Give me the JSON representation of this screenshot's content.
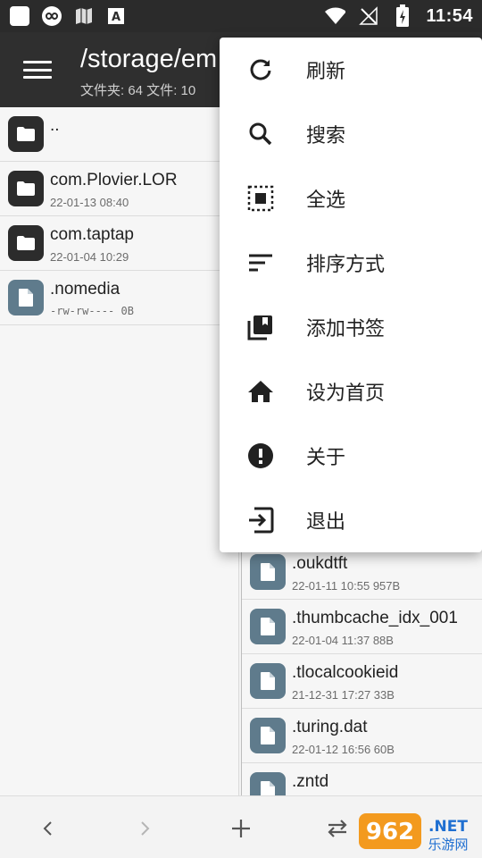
{
  "status_bar": {
    "time": "11:54",
    "left_icons": [
      "app-square-icon",
      "infinity-icon",
      "map-icon",
      "font-icon"
    ],
    "right_icons": [
      "wifi-icon",
      "no-signal-icon",
      "battery-charging-icon"
    ]
  },
  "app_bar": {
    "path": "/storage/em",
    "summary": "文件夹: 64  文件: 10"
  },
  "left_list": [
    {
      "name": "..",
      "meta": "",
      "type": "folder"
    },
    {
      "name": "com.Plovier.LOR",
      "meta": "22-01-13 08:40",
      "type": "folder"
    },
    {
      "name": "com.taptap",
      "meta": "22-01-04 10:29",
      "type": "folder"
    },
    {
      "name": ".nomedia",
      "meta": "-rw-rw----  0B",
      "type": "file"
    }
  ],
  "right_list": [
    {
      "name": ".oukdtft",
      "meta": "22-01-11 10:55  957B"
    },
    {
      "name": ".thumbcache_idx_001",
      "meta": "22-01-04 11:37  88B"
    },
    {
      "name": ".tlocalcookieid",
      "meta": "21-12-31 17:27  33B"
    },
    {
      "name": ".turing.dat",
      "meta": "22-01-12 16:56  60B"
    },
    {
      "name": ".zntd",
      "meta": ""
    }
  ],
  "menu": {
    "items": [
      {
        "label": "刷新",
        "icon": "refresh-icon"
      },
      {
        "label": "搜索",
        "icon": "search-icon"
      },
      {
        "label": "全选",
        "icon": "select-all-icon"
      },
      {
        "label": "排序方式",
        "icon": "sort-icon"
      },
      {
        "label": "添加书签",
        "icon": "bookmark-add-icon"
      },
      {
        "label": "设为首页",
        "icon": "home-icon"
      },
      {
        "label": "关于",
        "icon": "info-icon"
      },
      {
        "label": "退出",
        "icon": "exit-icon"
      }
    ]
  },
  "bottom_bar": {
    "buttons": [
      "back-icon",
      "forward-icon",
      "add-icon",
      "swap-icon"
    ]
  },
  "watermark": {
    "text": "962.NET",
    "subtext": "乐游网"
  },
  "colors": {
    "app_bar": "#2f2f2f",
    "status_bar": "#2b2b2b",
    "folder_icon_bg": "#2c2c2c",
    "file_icon_bg": "#5f7b8c",
    "menu_bg": "#ffffff"
  }
}
